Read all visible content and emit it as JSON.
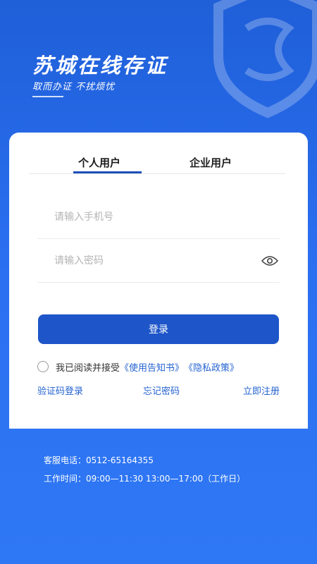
{
  "header": {
    "app_title": "苏城在线存证",
    "slogan": "取而办证 不扰烦忧"
  },
  "tabs": [
    {
      "label": "个人用户",
      "active": true
    },
    {
      "label": "企业用户",
      "active": false
    }
  ],
  "form": {
    "phone_placeholder": "请输入手机号",
    "password_placeholder": "请输入密码",
    "login_label": "登录"
  },
  "agreement": {
    "prefix": "我已阅读并接受",
    "link1": "《使用告知书》",
    "link2": "《隐私政策》"
  },
  "links": {
    "sms_login": "验证码登录",
    "forgot_password": "忘记密码",
    "register": "立即注册"
  },
  "footer": {
    "service_phone": "客服电话：0512-65164355",
    "work_hours": "工作时间：09:00—11:30 13:00—17:00（工作日）"
  },
  "colors": {
    "primary": "#1e56c9",
    "link": "#2563d1",
    "background": "#2a6ff0"
  }
}
